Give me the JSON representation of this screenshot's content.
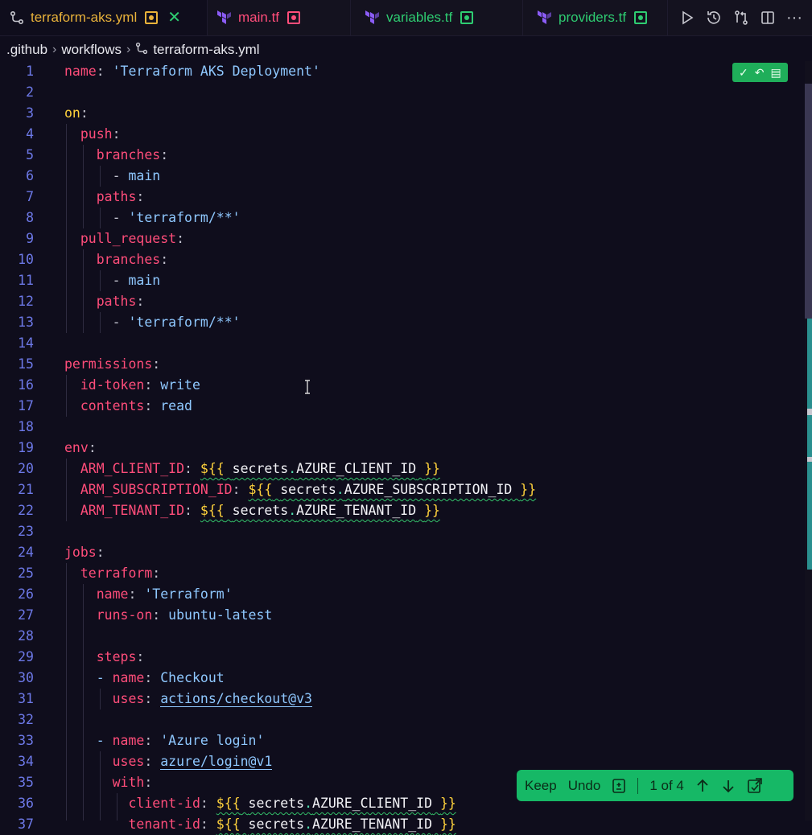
{
  "tabs": [
    {
      "label": "terraform-aks.yml",
      "color": "#e9b23a",
      "dot_color": "#e9b23a",
      "active": true,
      "icon": "git-workflow-icon"
    },
    {
      "label": "main.tf",
      "color": "#ff4d7a",
      "dot_color": "#ff4d7a",
      "active": false,
      "icon": "terraform-icon"
    },
    {
      "label": "variables.tf",
      "color": "#2ecc71",
      "dot_color": "#2ecc71",
      "active": false,
      "icon": "terraform-icon"
    },
    {
      "label": "providers.tf",
      "color": "#2ecc71",
      "dot_color": "#2ecc71",
      "active": false,
      "icon": "terraform-icon"
    }
  ],
  "breadcrumb": {
    "folder1": ".github",
    "folder2": "workflows",
    "file": "terraform-aks.yml"
  },
  "editor": {
    "line_numbers": [
      "1",
      "2",
      "3",
      "4",
      "5",
      "6",
      "7",
      "8",
      "9",
      "10",
      "11",
      "12",
      "13",
      "14",
      "15",
      "16",
      "17",
      "18",
      "19",
      "20",
      "21",
      "22",
      "23",
      "24",
      "25",
      "26",
      "27",
      "28",
      "29",
      "30",
      "31",
      "32",
      "33",
      "34",
      "35",
      "36",
      "37"
    ],
    "tokens": {
      "l1_key": "name",
      "l1_val": "'Terraform AKS Deployment'",
      "l3_key": "on",
      "l4_key": "push",
      "l5_key": "branches",
      "l6_val": "main",
      "l7_key": "paths",
      "l8_val": "'terraform/**'",
      "l9_key": "pull_request",
      "l10_key": "branches",
      "l11_val": "main",
      "l12_key": "paths",
      "l13_val": "'terraform/**'",
      "l15_key": "permissions",
      "l16_key": "id-token",
      "l16_val": "write",
      "l17_key": "contents",
      "l17_val": "read",
      "l19_key": "env",
      "l20_key": "ARM_CLIENT_ID",
      "l20_secret": "AZURE_CLIENT_ID",
      "l21_key": "ARM_SUBSCRIPTION_ID",
      "l21_secret": "AZURE_SUBSCRIPTION_ID",
      "l22_key": "ARM_TENANT_ID",
      "l22_secret": "AZURE_TENANT_ID",
      "l24_key": "jobs",
      "l25_key": "terraform",
      "l26_key": "name",
      "l26_val": "'Terraform'",
      "l27_key": "runs-on",
      "l27_val": "ubuntu-latest",
      "l29_key": "steps",
      "l30_key": "name",
      "l30_val": "Checkout",
      "l31_key": "uses",
      "l31_val": "actions/checkout@v3",
      "l33_key": "name",
      "l33_val": "'Azure login'",
      "l34_key": "uses",
      "l34_val": "azure/login@v1",
      "l35_key": "with",
      "l36_key": "client-id",
      "l36_secret": "AZURE_CLIENT_ID",
      "l37_key": "tenant-id",
      "l37_secret": "AZURE_TENANT_ID",
      "secrets_word": "secrets",
      "open": "${{",
      "close": "}}"
    }
  },
  "review_bar": {
    "keep_label": "Keep",
    "undo_label": "Undo",
    "counter": "1 of 4"
  },
  "colors": {
    "accent_green": "#16b866",
    "key_pink": "#ff4d7a",
    "line_number_blue": "#6d79e8"
  }
}
